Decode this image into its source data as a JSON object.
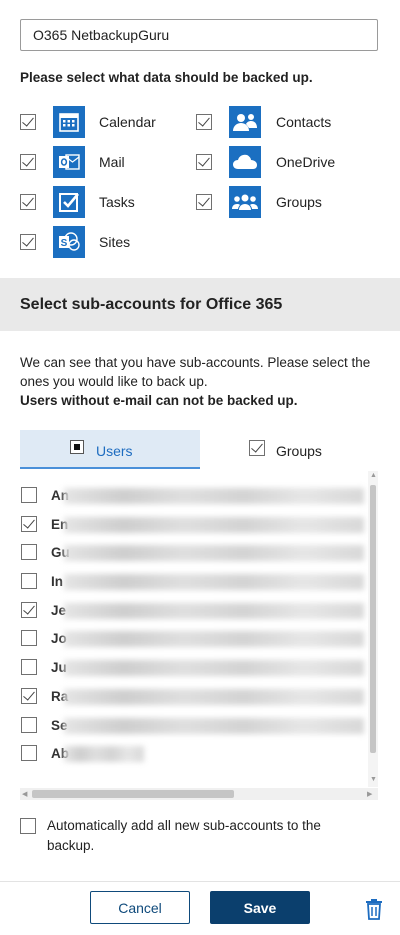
{
  "account_name": "O365 NetbackupGuru",
  "prompt": "Please select what data should be backed up.",
  "services": [
    {
      "label": "Calendar",
      "icon": "calendar-icon",
      "checked": true
    },
    {
      "label": "Contacts",
      "icon": "contacts-icon",
      "checked": true
    },
    {
      "label": "Mail",
      "icon": "mail-icon",
      "checked": true
    },
    {
      "label": "OneDrive",
      "icon": "onedrive-icon",
      "checked": true
    },
    {
      "label": "Tasks",
      "icon": "tasks-icon",
      "checked": true
    },
    {
      "label": "Groups",
      "icon": "groups-icon",
      "checked": true
    },
    {
      "label": "Sites",
      "icon": "sites-icon",
      "checked": true
    }
  ],
  "section_title": "Select sub-accounts for Office 365",
  "note": "We can see that you have sub-accounts. Please select the ones you would like to back up.",
  "note_bold": "Users without e-mail can not be backed up.",
  "tabs": {
    "users": "Users",
    "groups": "Groups"
  },
  "users": [
    {
      "prefix": "An",
      "checked": false
    },
    {
      "prefix": "En",
      "checked": true
    },
    {
      "prefix": "Gu",
      "checked": false
    },
    {
      "prefix": "In",
      "checked": false
    },
    {
      "prefix": "Je",
      "checked": true
    },
    {
      "prefix": "Jo",
      "checked": false
    },
    {
      "prefix": "Ju",
      "checked": false
    },
    {
      "prefix": "Ra",
      "checked": true
    },
    {
      "prefix": "Se",
      "checked": false
    },
    {
      "prefix": "Ab",
      "checked": false
    }
  ],
  "auto_add": "Automatically add all new sub-accounts to the backup.",
  "buttons": {
    "cancel": "Cancel",
    "save": "Save"
  },
  "colors": {
    "accent": "#1b6fc1",
    "primary_button": "#0b3f6d",
    "tab_active_bg": "#dfeaf5",
    "section_bg": "#e9e9e9"
  }
}
